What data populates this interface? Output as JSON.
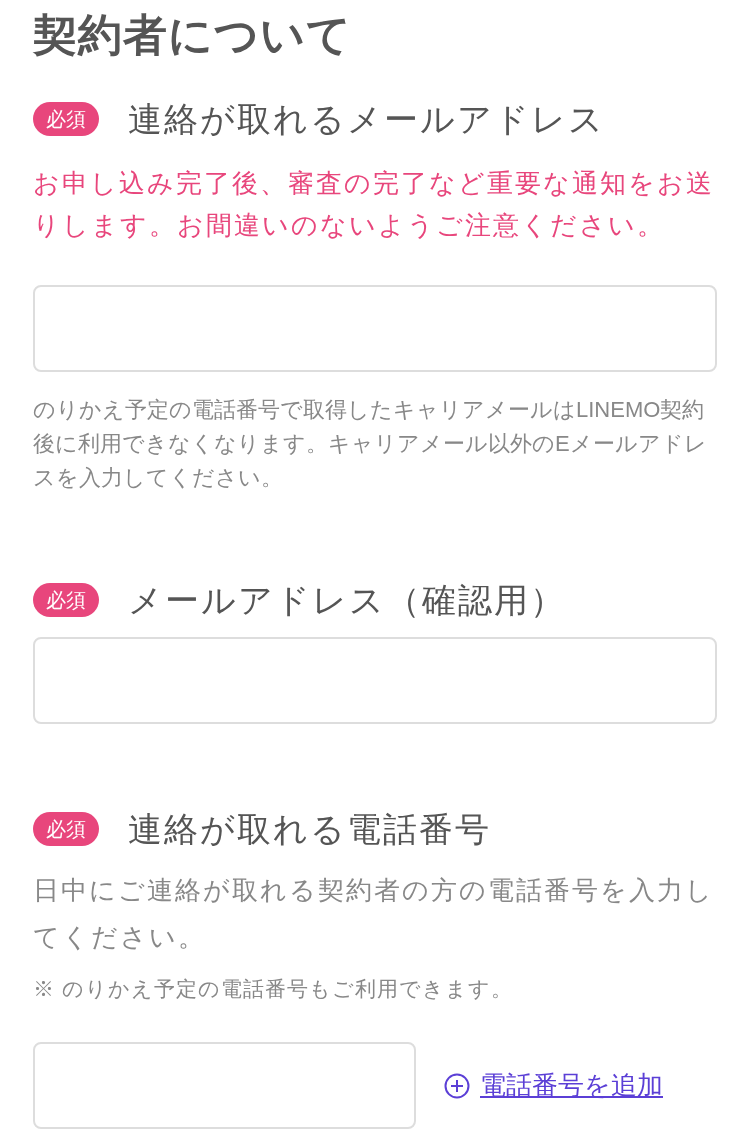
{
  "title": "契約者について",
  "fields": [
    {
      "kind": "email",
      "badge": "必須",
      "label": "連絡が取れるメールアドレス",
      "notice": "お申し込み完了後、審査の完了など重要な通知をお送りします。お間違いのないようご注意ください。",
      "hint": "のりかえ予定の電話番号で取得したキャリアメールはLINEMO契約後に利用できなくなります。キャリアメール以外のEメールアドレスを入力してください。"
    },
    {
      "kind": "email_confirm",
      "badge": "必須",
      "label": "メールアドレス（確認用）"
    },
    {
      "kind": "phone",
      "badge": "必須",
      "label": "連絡が取れる電話番号",
      "description": "日中にご連絡が取れる契約者の方の電話番号を入力してください。",
      "note": "※ のりかえ予定の電話番号もご利用できます。",
      "add_link": "電話番号を追加"
    }
  ]
}
